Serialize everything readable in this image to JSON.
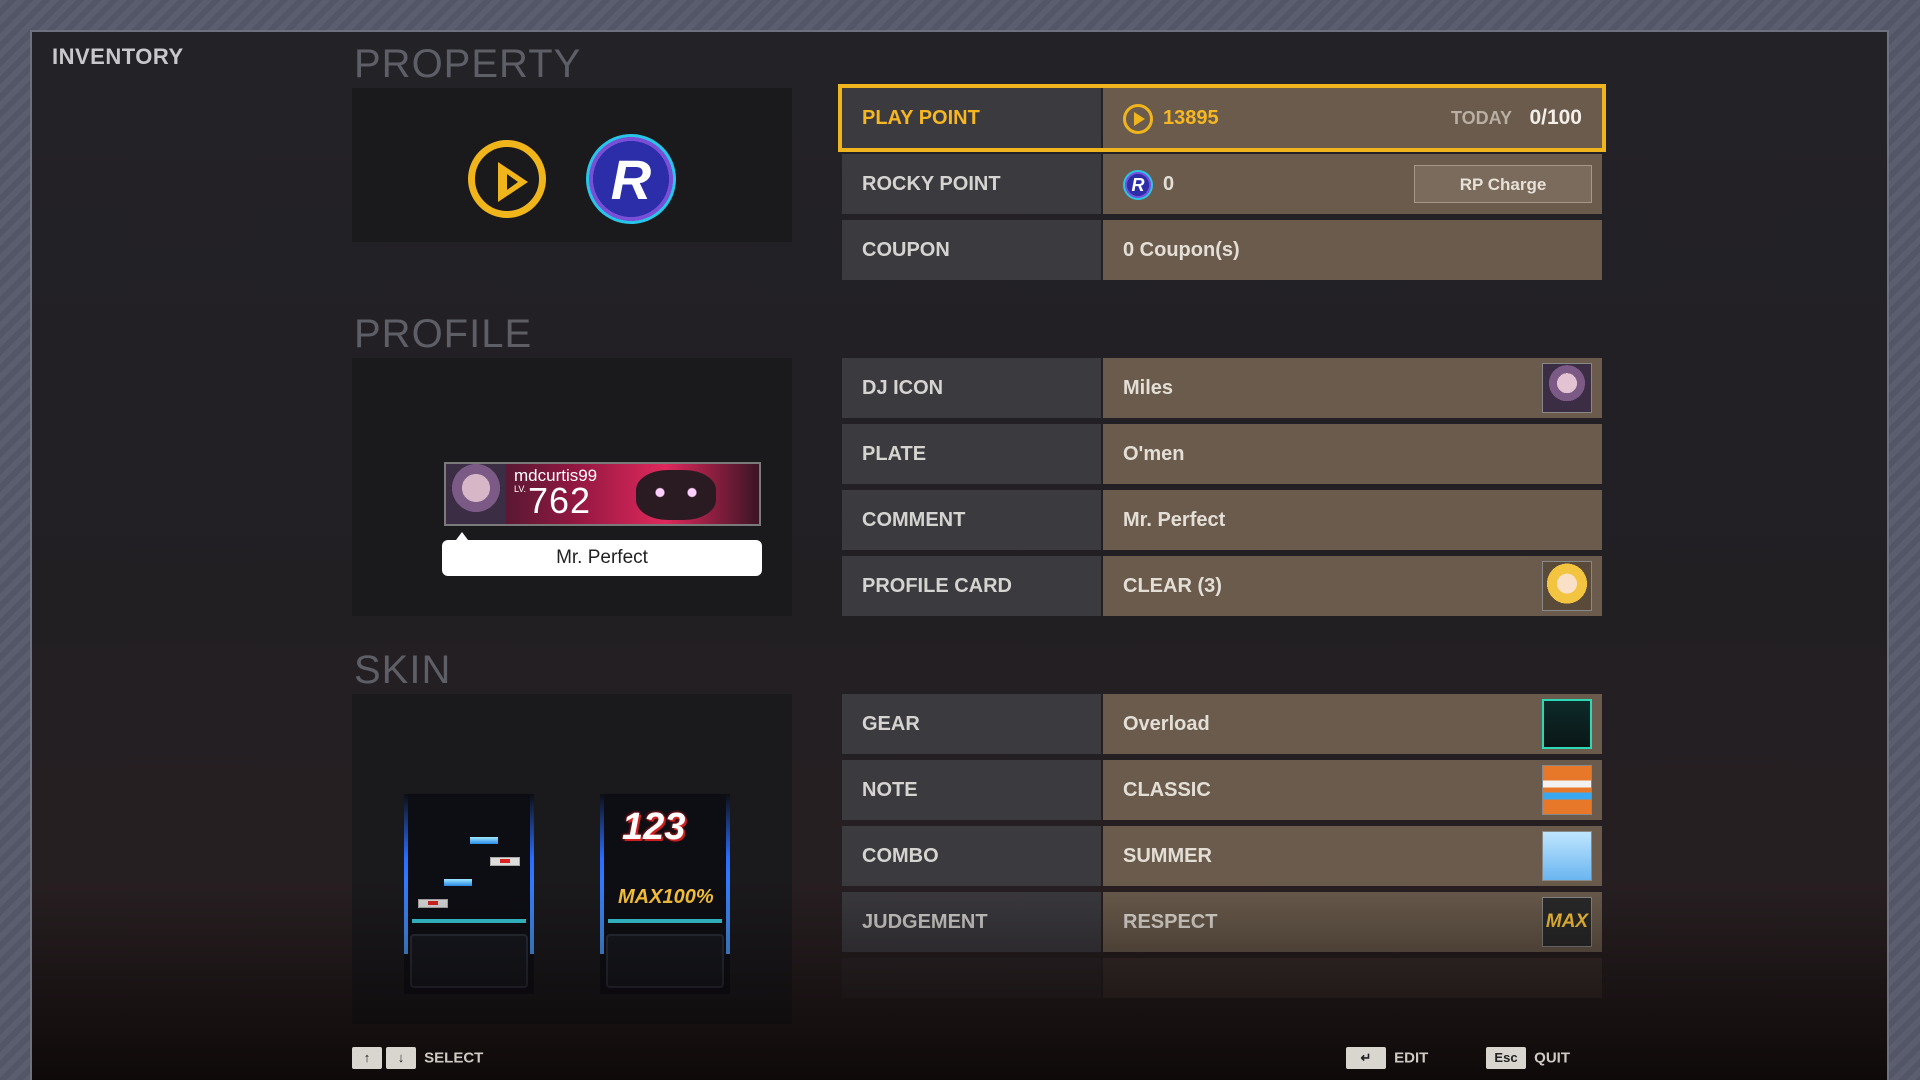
{
  "page_title": "INVENTORY",
  "sections": {
    "property": "PROPERTY",
    "profile": "PROFILE",
    "skin": "SKIN"
  },
  "property": {
    "play_point": {
      "label": "PLAY POINT",
      "value": "13895",
      "today_label": "TODAY",
      "today_value": "0/100"
    },
    "rocky_point": {
      "label": "ROCKY POINT",
      "value": "0",
      "charge_button": "RP Charge"
    },
    "coupon": {
      "label": "COUPON",
      "value": "0 Coupon(s)"
    }
  },
  "profile": {
    "plate": {
      "username": "mdcurtis99",
      "lv_label": "LV.",
      "level": "762"
    },
    "comment_preview": "Mr. Perfect",
    "rows": [
      {
        "label": "DJ ICON",
        "value": "Miles"
      },
      {
        "label": "PLATE",
        "value": "O'men"
      },
      {
        "label": "COMMENT",
        "value": "Mr. Perfect"
      },
      {
        "label": "PROFILE CARD",
        "value": "CLEAR (3)"
      }
    ]
  },
  "skin": {
    "preview_combo": "123",
    "preview_max": "MAX100%",
    "rows": [
      {
        "label": "GEAR",
        "value": "Overload"
      },
      {
        "label": "NOTE",
        "value": "CLASSIC"
      },
      {
        "label": "COMBO",
        "value": "SUMMER"
      },
      {
        "label": "JUDGEMENT",
        "value": "RESPECT"
      }
    ],
    "judgement_thumb_text": "MAX"
  },
  "footer": {
    "select": "SELECT",
    "edit": "EDIT",
    "quit": "QUIT",
    "key_up": "↑",
    "key_down": "↓",
    "key_enter": "↵",
    "key_esc": "Esc"
  },
  "colors": {
    "accent": "#f0b51d",
    "label_bg": "#3b3a3f",
    "value_bg": "#6a5b4c"
  },
  "icons": {
    "play_point": "play-point-coin-icon",
    "rocky_point": "rocky-point-coin-icon"
  }
}
